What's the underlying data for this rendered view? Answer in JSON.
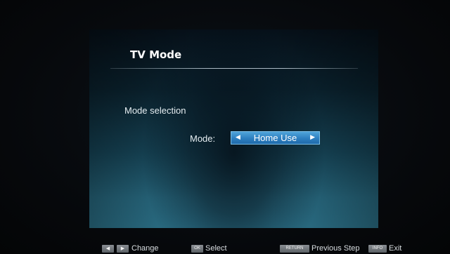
{
  "menu": {
    "title": "TV Mode",
    "section_label": "Mode selection",
    "mode_label": "Mode:",
    "mode_value": "Home Use"
  },
  "footer": {
    "change_hint": "Change",
    "ok_key": "OK",
    "select_hint": "Select",
    "return_key": "RETURN",
    "previous_hint": "Previous Step",
    "info_key": "INFO",
    "exit_hint": "Exit"
  },
  "icons": {
    "left_arrow": "◀",
    "right_arrow": "▶"
  },
  "colors": {
    "selector_highlight": "#2d7fc0",
    "panel_accent": "#2e7790"
  }
}
